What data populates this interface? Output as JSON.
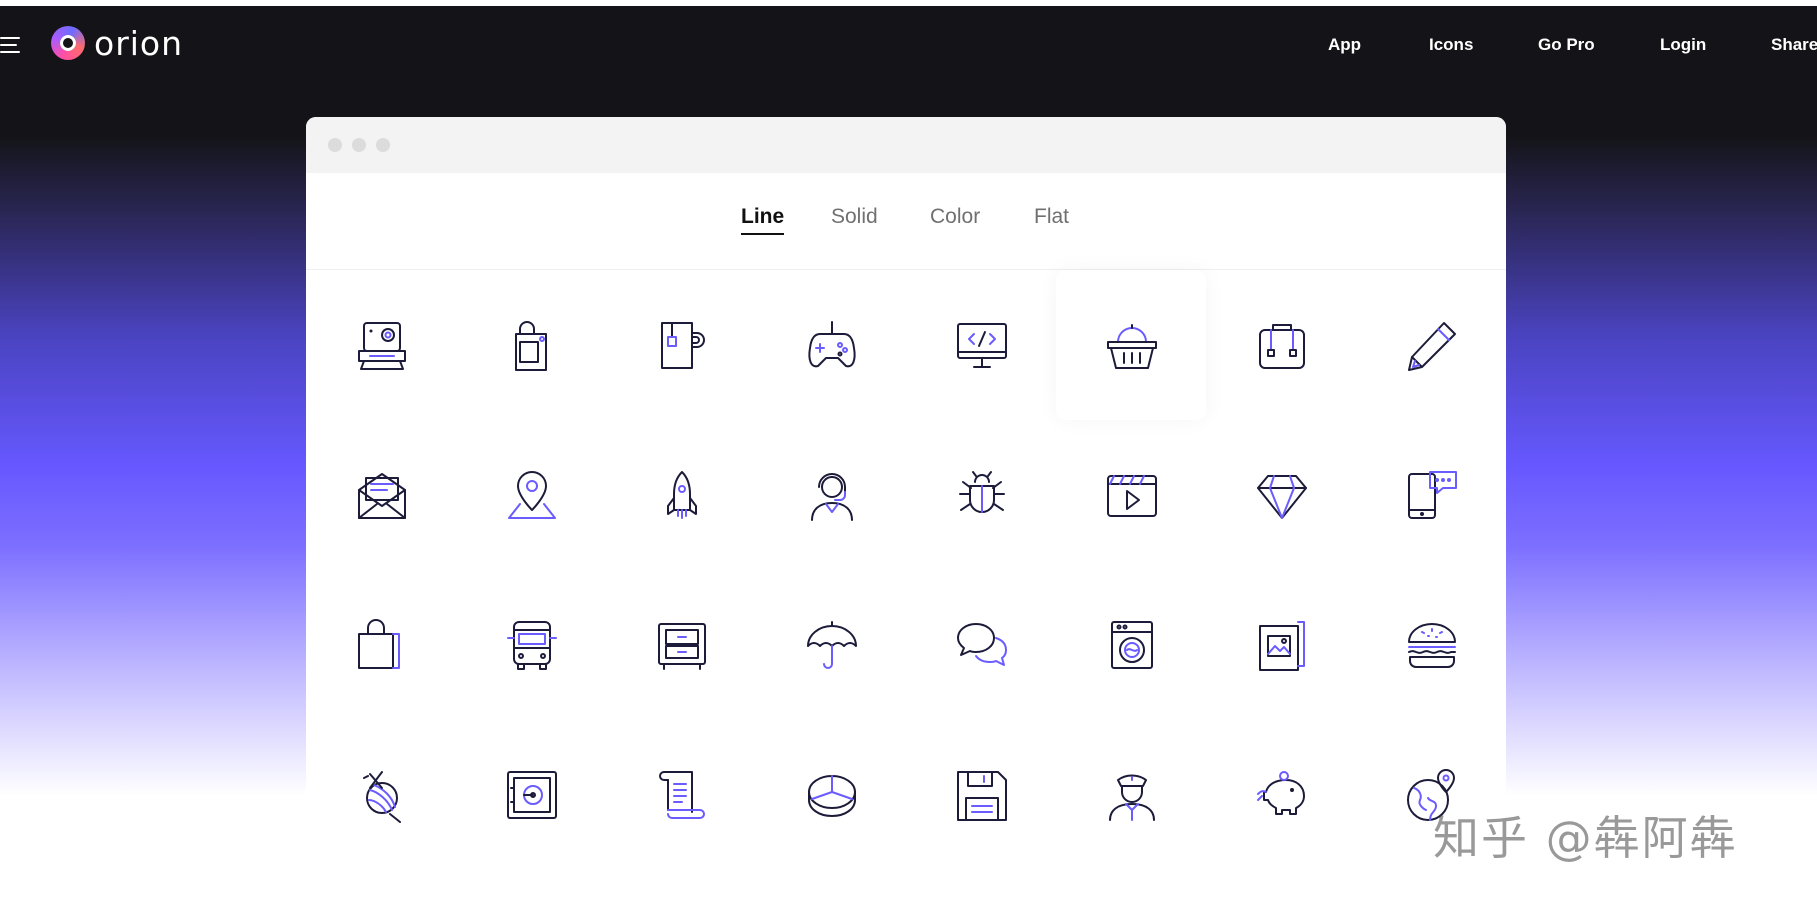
{
  "brand": {
    "name": "orion"
  },
  "nav": {
    "links": [
      "App",
      "Icons",
      "Go Pro",
      "Login",
      "Share"
    ]
  },
  "tabs": [
    {
      "label": "Line",
      "active": true
    },
    {
      "label": "Solid",
      "active": false
    },
    {
      "label": "Color",
      "active": false
    },
    {
      "label": "Flat",
      "active": false
    }
  ],
  "icon_rows": [
    [
      "instant-camera",
      "trash-bin",
      "tea-mug",
      "game-controller",
      "code-monitor",
      "shopping-basket",
      "backpack",
      "pencil"
    ],
    [
      "open-mail",
      "map-pin",
      "rocket",
      "customer-support",
      "bug",
      "video-player",
      "diamond",
      "mobile-chat"
    ],
    [
      "shopping-bag",
      "bus",
      "drawer-cabinet",
      "umbrella",
      "chat-bubbles",
      "washing-machine",
      "picture-frame",
      "burger"
    ],
    [
      "yarn-ball",
      "safe",
      "scroll",
      "pie-chart",
      "floppy-disk",
      "police-officer",
      "piggy-bank",
      "globe-pin"
    ]
  ],
  "colors": {
    "header_bg": "#141418",
    "accent": "#6a5cff",
    "gradient_mid": "#6658ff",
    "icon_stroke": "#1c1c3a"
  },
  "watermark": "知乎 @犇阿犇"
}
